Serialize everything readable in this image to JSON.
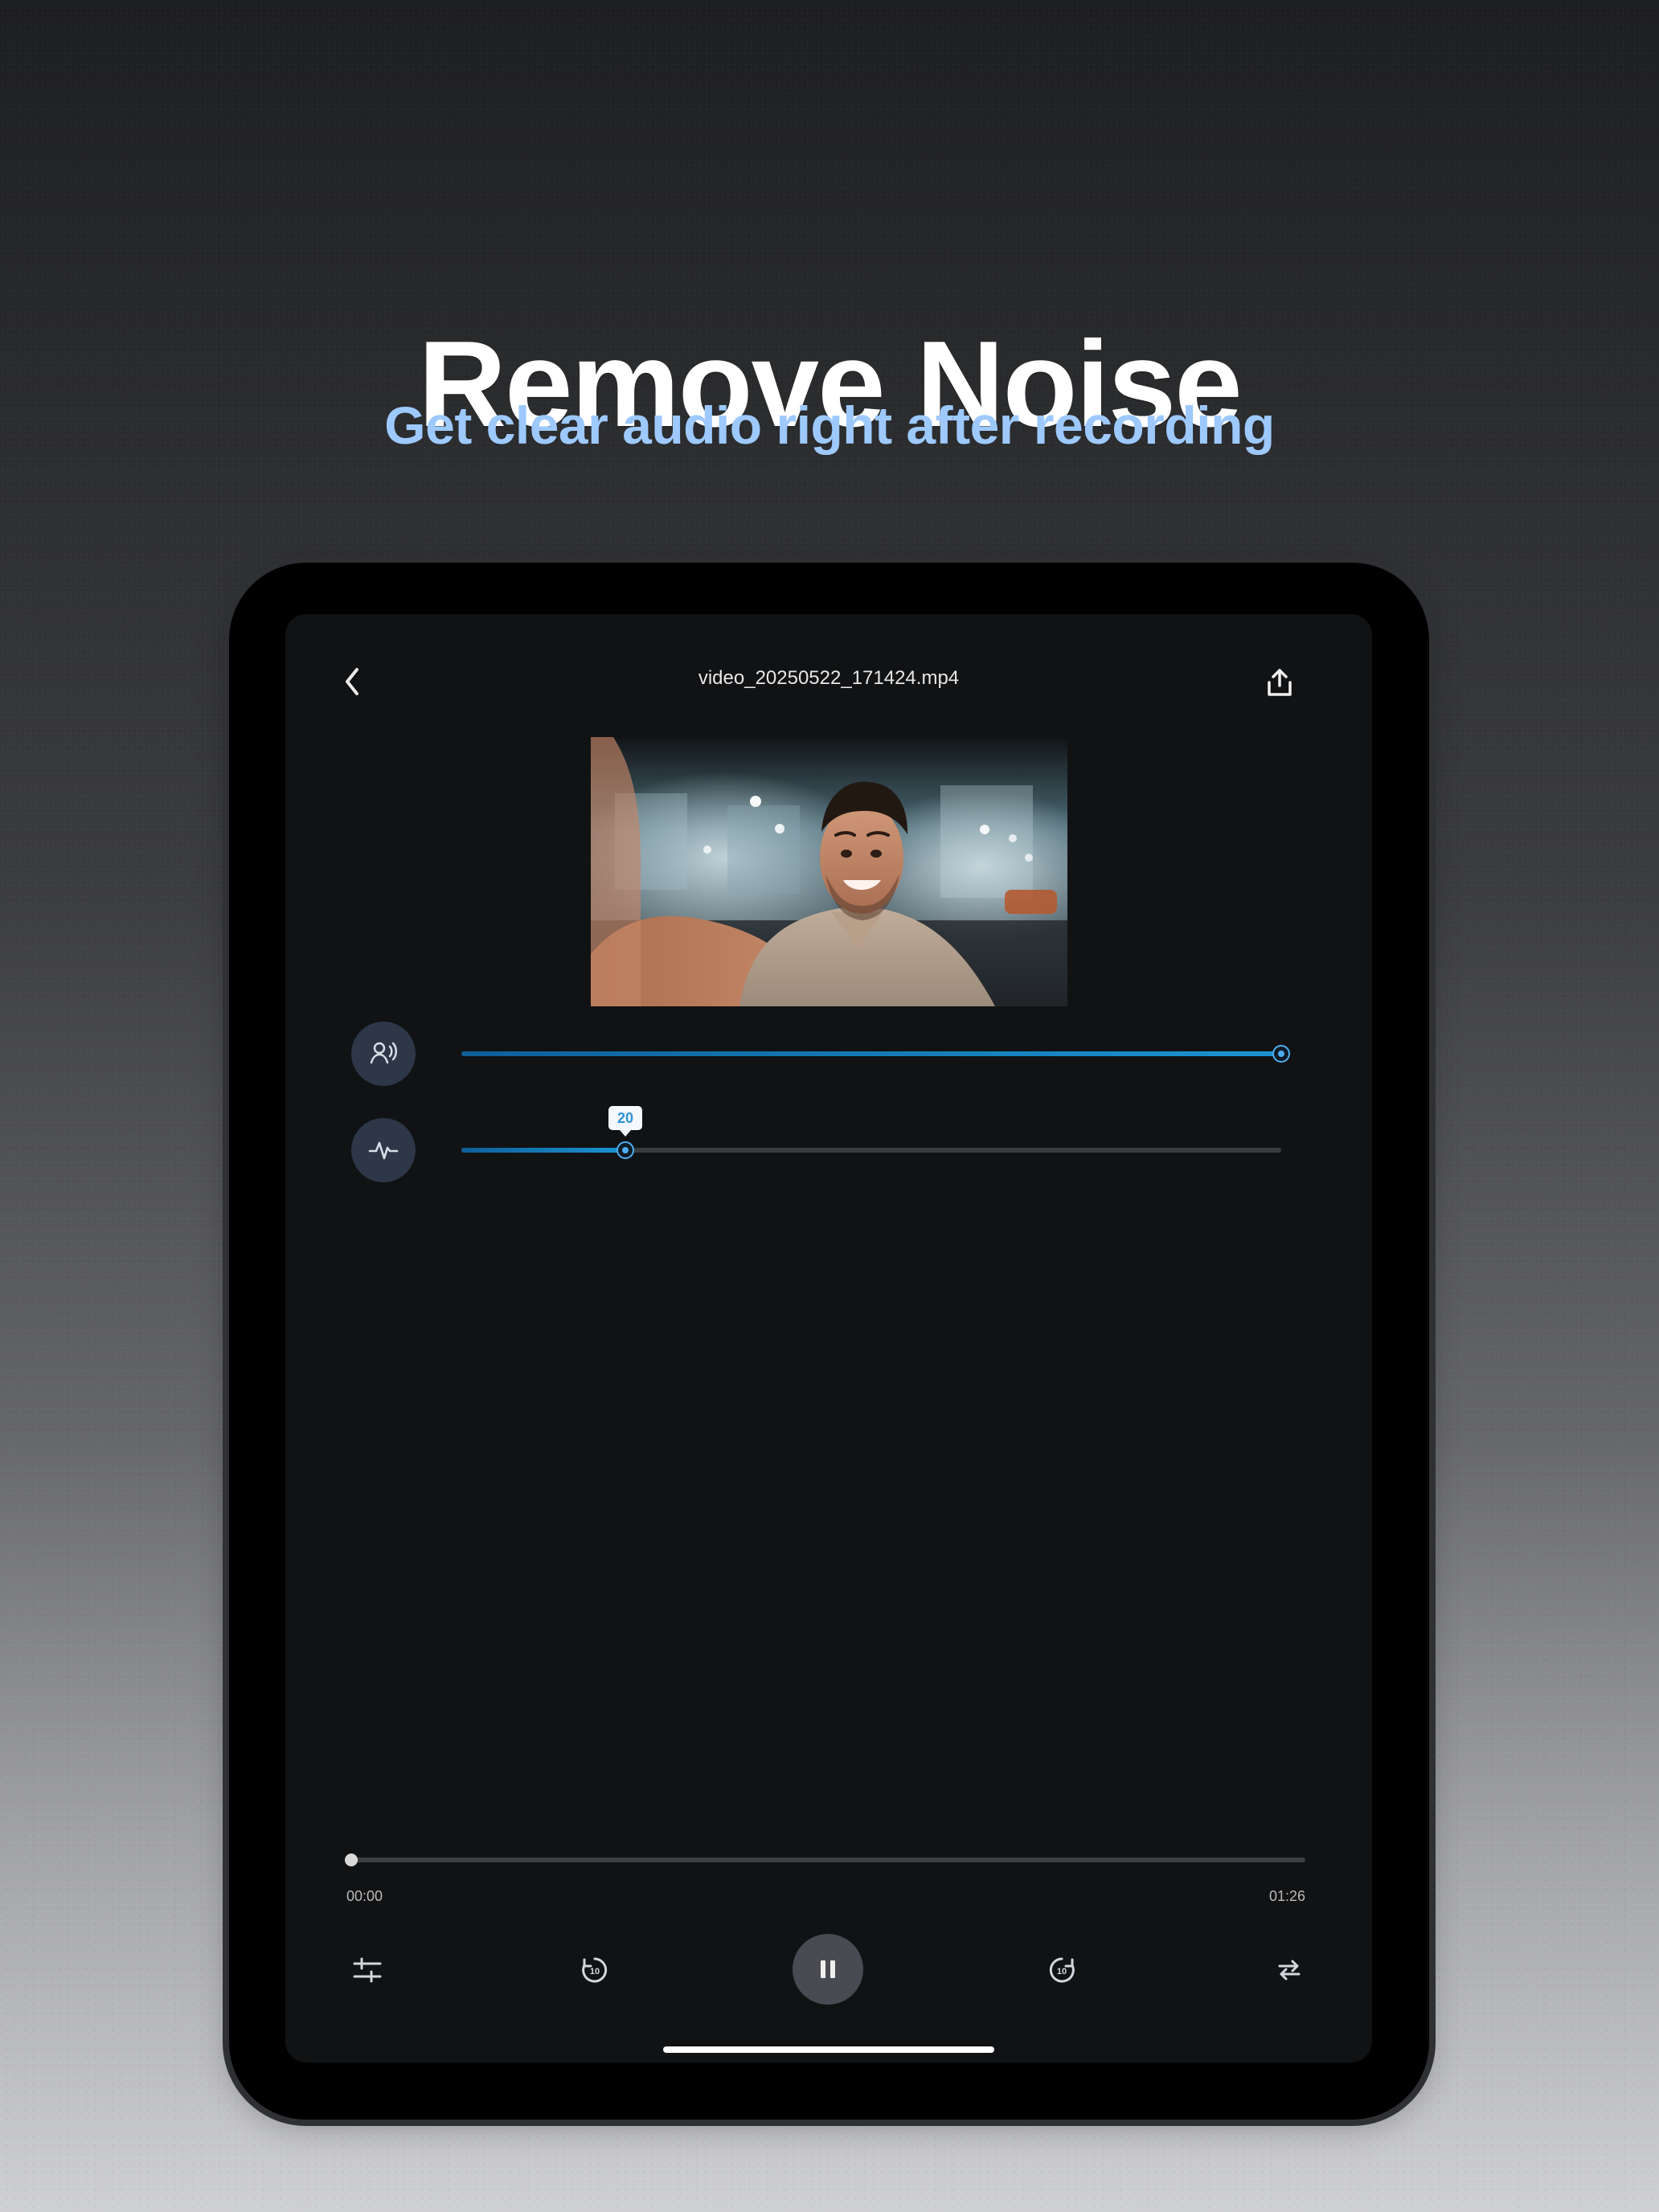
{
  "marketing": {
    "headline": "Remove Noise",
    "subheadline": "Get clear audio right after recording"
  },
  "player": {
    "filename": "video_20250522_171424.mp4",
    "voice_level": 100,
    "noise_reduction_level": 20,
    "noise_reduction_badge": "20",
    "progress": 0,
    "time_current": "00:00",
    "time_total": "01:26",
    "skip_back_label": "10",
    "skip_forward_label": "10"
  },
  "icons": {
    "back": "chevron-left-icon",
    "share": "share-icon",
    "voice": "voice-icon",
    "noise": "waveform-icon",
    "filter": "sliders-icon",
    "rewind": "rewind-10-icon",
    "pause": "pause-icon",
    "forward": "forward-10-icon",
    "repeat": "repeat-icon"
  },
  "colors": {
    "accent": "#1b94d2",
    "subheadline": "#9dc9ff",
    "screen_bg": "#111214",
    "icon_circle_bg": "#2d3748"
  }
}
